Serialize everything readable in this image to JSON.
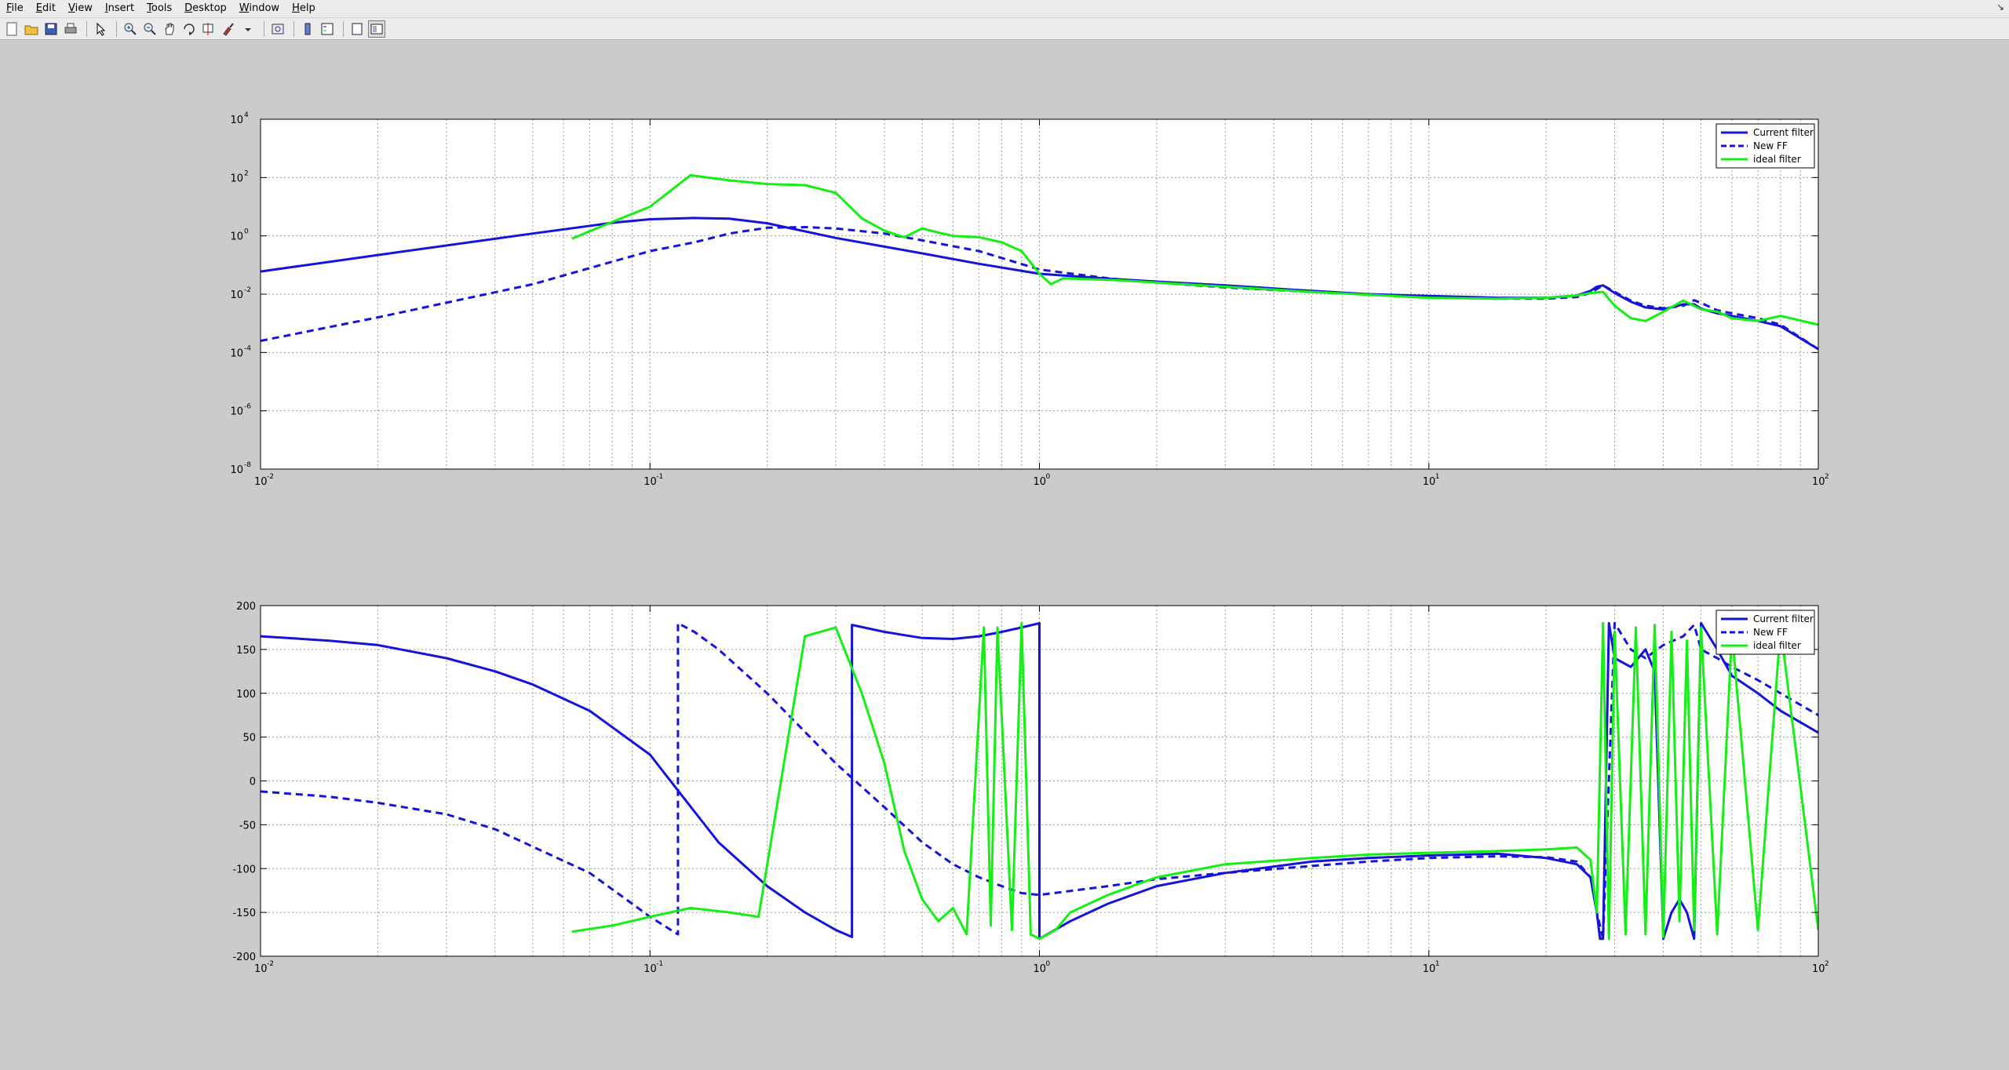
{
  "menu": [
    {
      "label": "File",
      "accel": "F",
      "rest": "ile"
    },
    {
      "label": "Edit",
      "accel": "E",
      "rest": "dit"
    },
    {
      "label": "View",
      "accel": "V",
      "rest": "iew"
    },
    {
      "label": "Insert",
      "accel": "I",
      "rest": "nsert"
    },
    {
      "label": "Tools",
      "accel": "T",
      "rest": "ools"
    },
    {
      "label": "Desktop",
      "accel": "D",
      "rest": "esktop"
    },
    {
      "label": "Window",
      "accel": "W",
      "rest": "indow"
    },
    {
      "label": "Help",
      "accel": "H",
      "rest": "elp"
    }
  ],
  "window_corner_glyph": "↘",
  "toolbar_icons": [
    "new-figure-icon",
    "open-file-icon",
    "save-icon",
    "print-icon",
    "|",
    "edit-plot-arrow-icon",
    "|",
    "zoom-in-icon",
    "zoom-out-icon",
    "pan-hand-icon",
    "rotate-3d-icon",
    "data-cursor-icon",
    "brush-icon",
    "brush-dropdown-icon",
    "|",
    "link-plot-icon",
    "|",
    "colorbar-icon",
    "legend-icon",
    "|",
    "hide-plot-tools-icon",
    "show-plot-tools-icon"
  ],
  "colors": {
    "current_filter": "#1414dc",
    "new_ff": "#1414dc",
    "ideal_filter": "#14f014",
    "grid": "#999999"
  },
  "chart_data": [
    {
      "type": "line",
      "name": "magnitude",
      "xscale": "log",
      "yscale": "log",
      "xlim": [
        0.01,
        100
      ],
      "ylim": [
        1e-08,
        10000.0
      ],
      "grid": true,
      "legend_position": "top-right",
      "x_ticks": [
        {
          "base": "10",
          "exp": "-2"
        },
        {
          "base": "10",
          "exp": "-1"
        },
        {
          "base": "10",
          "exp": "0"
        },
        {
          "base": "10",
          "exp": "1"
        },
        {
          "base": "10",
          "exp": "2"
        }
      ],
      "y_ticks": [
        {
          "base": "10",
          "exp": "-8"
        },
        {
          "base": "10",
          "exp": "-6"
        },
        {
          "base": "10",
          "exp": "-4"
        },
        {
          "base": "10",
          "exp": "-2"
        },
        {
          "base": "10",
          "exp": "0"
        },
        {
          "base": "10",
          "exp": "2"
        },
        {
          "base": "10",
          "exp": "4"
        }
      ],
      "series": [
        {
          "name": "Current filter",
          "style": "solid",
          "x": [
            0.01,
            0.02,
            0.05,
            0.08,
            0.1,
            0.13,
            0.16,
            0.2,
            0.3,
            0.5,
            0.7,
            1.0,
            1.5,
            2,
            3,
            5,
            7,
            10,
            15,
            20,
            24,
            26,
            27,
            28,
            30,
            33,
            36,
            40,
            45,
            48,
            50,
            55,
            60,
            70,
            80,
            100
          ],
          "y": [
            0.06,
            0.22,
            1.2,
            2.8,
            3.7,
            4.1,
            3.9,
            2.7,
            0.85,
            0.25,
            0.11,
            0.05,
            0.034,
            0.027,
            0.02,
            0.013,
            0.01,
            0.0087,
            0.0075,
            0.0075,
            0.009,
            0.013,
            0.018,
            0.02,
            0.011,
            0.0055,
            0.0035,
            0.003,
            0.0045,
            0.0045,
            0.0032,
            0.0022,
            0.0018,
            0.0012,
            0.0008,
            0.00013
          ]
        },
        {
          "name": "New FF",
          "style": "dashed",
          "x": [
            0.01,
            0.02,
            0.05,
            0.08,
            0.1,
            0.13,
            0.16,
            0.2,
            0.25,
            0.3,
            0.4,
            0.5,
            0.7,
            1.0,
            1.5,
            2,
            3,
            5,
            7,
            10,
            15,
            20,
            24,
            26,
            27,
            28,
            30,
            33,
            36,
            40,
            45,
            48,
            50,
            55,
            60,
            70,
            80,
            100
          ],
          "y": [
            0.00025,
            0.0016,
            0.022,
            0.13,
            0.3,
            0.6,
            1.2,
            1.9,
            2.0,
            1.8,
            1.2,
            0.7,
            0.3,
            0.07,
            0.035,
            0.025,
            0.017,
            0.012,
            0.0097,
            0.0083,
            0.007,
            0.007,
            0.008,
            0.011,
            0.015,
            0.02,
            0.012,
            0.006,
            0.004,
            0.0033,
            0.004,
            0.0062,
            0.005,
            0.0028,
            0.0022,
            0.0015,
            0.0009,
            0.00013
          ]
        },
        {
          "name": "ideal filter",
          "style": "solid",
          "x": [
            0.063,
            0.08,
            0.1,
            0.127,
            0.16,
            0.2,
            0.25,
            0.3,
            0.35,
            0.4,
            0.45,
            0.5,
            0.55,
            0.6,
            0.7,
            0.8,
            0.9,
            1.0,
            1.07,
            1.15,
            1.3,
            1.6,
            2,
            3,
            5,
            7,
            10,
            15,
            20,
            24,
            26,
            28,
            30,
            33,
            36,
            40,
            45,
            48,
            50,
            55,
            60,
            70,
            80,
            100
          ],
          "y": [
            0.8,
            3.0,
            10,
            120,
            80,
            60,
            55,
            30,
            4.0,
            1.5,
            0.9,
            1.8,
            1.3,
            1.0,
            0.9,
            0.6,
            0.3,
            0.05,
            0.022,
            0.035,
            0.033,
            0.03,
            0.025,
            0.018,
            0.012,
            0.0095,
            0.0075,
            0.007,
            0.0075,
            0.009,
            0.011,
            0.012,
            0.004,
            0.0015,
            0.0012,
            0.0025,
            0.006,
            0.004,
            0.003,
            0.0025,
            0.0015,
            0.0012,
            0.0018,
            0.0009
          ]
        }
      ]
    },
    {
      "type": "line",
      "name": "phase",
      "xscale": "log",
      "yscale": "linear",
      "xlim": [
        0.01,
        100
      ],
      "ylim": [
        -200,
        200
      ],
      "grid": true,
      "legend_position": "top-right",
      "x_ticks": [
        {
          "base": "10",
          "exp": "-2"
        },
        {
          "base": "10",
          "exp": "-1"
        },
        {
          "base": "10",
          "exp": "0"
        },
        {
          "base": "10",
          "exp": "1"
        },
        {
          "base": "10",
          "exp": "2"
        }
      ],
      "y_ticks": [
        "-200",
        "-150",
        "-100",
        "-50",
        "0",
        "50",
        "100",
        "150",
        "200"
      ],
      "series": [
        {
          "name": "Current filter",
          "style": "solid",
          "x": [
            0.01,
            0.015,
            0.02,
            0.03,
            0.04,
            0.05,
            0.07,
            0.1,
            0.12,
            0.15,
            0.2,
            0.25,
            0.3,
            0.33,
            0.33,
            0.4,
            0.5,
            0.6,
            0.7,
            0.8,
            0.9,
            1.0,
            1.0,
            1.2,
            1.5,
            2,
            3,
            5,
            7,
            10,
            15,
            20,
            24,
            26,
            27,
            27.5,
            28,
            29,
            30,
            33,
            36,
            38,
            40,
            42,
            44,
            46,
            48,
            50,
            55,
            60,
            70,
            80,
            100
          ],
          "y": [
            165,
            160,
            155,
            140,
            125,
            110,
            80,
            30,
            -15,
            -70,
            -120,
            -150,
            -170,
            -178,
            178,
            170,
            163,
            162,
            165,
            170,
            175,
            180,
            -180,
            -160,
            -140,
            -120,
            -105,
            -92,
            -88,
            -85,
            -83,
            -88,
            -95,
            -110,
            -150,
            -180,
            -180,
            180,
            140,
            130,
            150,
            125,
            -180,
            -150,
            -135,
            -150,
            -180,
            180,
            150,
            120,
            100,
            80,
            55
          ]
        },
        {
          "name": "New FF",
          "style": "dashed",
          "x": [
            0.01,
            0.015,
            0.02,
            0.03,
            0.04,
            0.05,
            0.07,
            0.09,
            0.1,
            0.118,
            0.118,
            0.13,
            0.15,
            0.2,
            0.3,
            0.4,
            0.5,
            0.6,
            0.7,
            0.8,
            0.9,
            1.0,
            1.5,
            2,
            3,
            5,
            7,
            10,
            15,
            20,
            24,
            26,
            27,
            28,
            30,
            33,
            36,
            40,
            45,
            48,
            50,
            55,
            60,
            70,
            80,
            100
          ],
          "y": [
            -12,
            -18,
            -25,
            -38,
            -55,
            -75,
            -105,
            -140,
            -155,
            -175,
            180,
            170,
            150,
            100,
            20,
            -30,
            -70,
            -95,
            -110,
            -120,
            -128,
            -130,
            -120,
            -112,
            -105,
            -97,
            -92,
            -88,
            -86,
            -87,
            -92,
            -110,
            -150,
            -180,
            180,
            150,
            140,
            155,
            165,
            178,
            150,
            140,
            130,
            115,
            100,
            75
          ]
        },
        {
          "name": "ideal filter",
          "style": "solid",
          "x": [
            0.063,
            0.08,
            0.1,
            0.127,
            0.16,
            0.19,
            0.25,
            0.3,
            0.35,
            0.4,
            0.45,
            0.5,
            0.55,
            0.6,
            0.65,
            0.72,
            0.75,
            0.78,
            0.85,
            0.9,
            0.95,
            1.0,
            1.05,
            1.1,
            1.2,
            1.5,
            2,
            3,
            5,
            7,
            10,
            15,
            20,
            24,
            26,
            27,
            28,
            29,
            30,
            32,
            34,
            36,
            38,
            40,
            42,
            44,
            46,
            48,
            50,
            55,
            60,
            70,
            80,
            100
          ],
          "y": [
            -172,
            -165,
            -155,
            -145,
            -150,
            -155,
            165,
            175,
            100,
            20,
            -80,
            -135,
            -160,
            -145,
            -175,
            175,
            -165,
            175,
            -170,
            180,
            -175,
            -180,
            -175,
            -170,
            -150,
            -130,
            -110,
            -95,
            -88,
            -84,
            -82,
            -80,
            -78,
            -76,
            -90,
            -150,
            180,
            -180,
            170,
            -175,
            175,
            -175,
            178,
            -178,
            170,
            -160,
            160,
            -170,
            175,
            -175,
            170,
            -170,
            175,
            -170
          ]
        }
      ]
    }
  ]
}
